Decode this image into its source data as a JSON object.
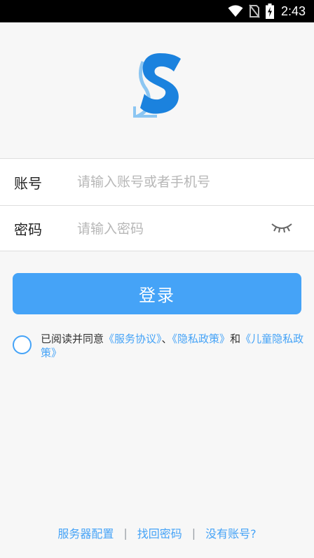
{
  "status_bar": {
    "time": "2:43",
    "icons": [
      "wifi-icon",
      "no-sim-icon",
      "battery-charging-icon"
    ]
  },
  "app": {
    "logo": "s-logo-icon",
    "accent_color": "#45a3f7"
  },
  "form": {
    "account_label": "账号",
    "account_placeholder": "请输入账号或者手机号",
    "password_label": "密码",
    "password_placeholder": "请输入密码",
    "password_toggle_icon": "eye-closed-icon"
  },
  "login_button": {
    "label": "登录"
  },
  "agreement": {
    "prefix": "已阅读并同意",
    "service_link": "《服务协议》",
    "sep1": "、",
    "privacy_link": "《隐私政策》",
    "and": "和",
    "child_privacy_link": "《儿童隐私政策》",
    "checked": false
  },
  "bottom_links": {
    "server_config": "服务器配置",
    "divider": "|",
    "retrieve_password": "找回密码",
    "no_account": "没有账号?"
  }
}
